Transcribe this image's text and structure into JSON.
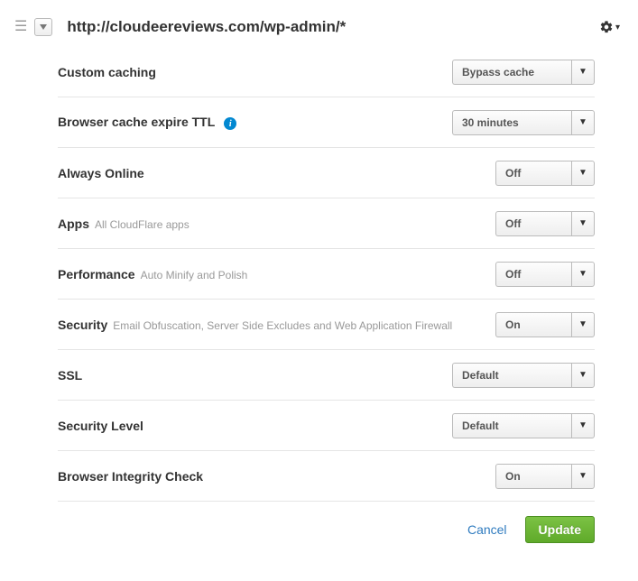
{
  "header": {
    "url": "http://cloudeereviews.com/wp-admin/*"
  },
  "rows": [
    {
      "label": "Custom caching",
      "sublabel": "",
      "info": false,
      "value": "Bypass cache",
      "width": "wide"
    },
    {
      "label": "Browser cache expire TTL",
      "sublabel": "",
      "info": true,
      "value": "30 minutes",
      "width": "wide"
    },
    {
      "label": "Always Online",
      "sublabel": "",
      "info": false,
      "value": "Off",
      "width": "narrow"
    },
    {
      "label": "Apps",
      "sublabel": "All CloudFlare apps",
      "info": false,
      "value": "Off",
      "width": "narrow"
    },
    {
      "label": "Performance",
      "sublabel": "Auto Minify and Polish",
      "info": false,
      "value": "Off",
      "width": "narrow"
    },
    {
      "label": "Security",
      "sublabel": "Email Obfuscation, Server Side Excludes and Web Application Firewall",
      "info": false,
      "value": "On",
      "width": "narrow"
    },
    {
      "label": "SSL",
      "sublabel": "",
      "info": false,
      "value": "Default",
      "width": "wide"
    },
    {
      "label": "Security Level",
      "sublabel": "",
      "info": false,
      "value": "Default",
      "width": "wide"
    },
    {
      "label": "Browser Integrity Check",
      "sublabel": "",
      "info": false,
      "value": "On",
      "width": "narrow"
    }
  ],
  "footer": {
    "cancel": "Cancel",
    "update": "Update"
  }
}
